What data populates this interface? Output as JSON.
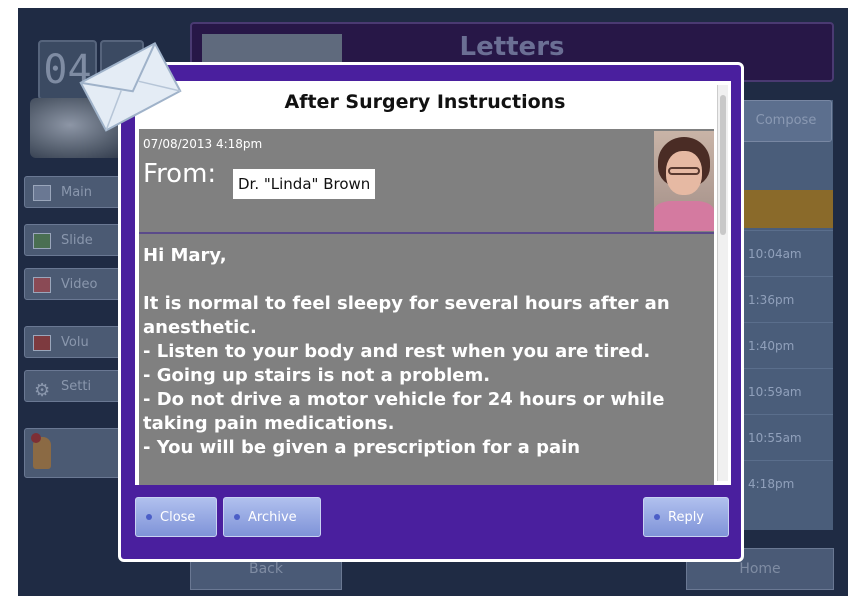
{
  "background_app": {
    "clock_digits": "04",
    "sidebar": [
      {
        "label": "Main",
        "style": "plain"
      },
      {
        "label": "Slide",
        "style": "green"
      },
      {
        "label": "Video",
        "style": "pink"
      },
      {
        "label": "Volu",
        "style": "red"
      },
      {
        "label": "Setti",
        "style": "gear"
      }
    ],
    "header_title": "Letters",
    "compose_label": "Compose",
    "times": [
      "10:04am",
      "1:36pm",
      "1:40pm",
      "10:59am",
      "10:55am",
      "4:18pm"
    ],
    "back_label": "Back",
    "home_label": "Home"
  },
  "dialog": {
    "title": "After Surgery Instructions",
    "date": "07/08/2013 4:18pm",
    "from_label": "From:",
    "from_name": "Dr. \"Linda\" Brown",
    "body": "Hi Mary,\n\nIt is normal to feel sleepy for several hours after an anesthetic.\n- Listen to your body and rest when you are tired.\n- Going up stairs is not a problem.\n- Do not drive a motor vehicle for 24 hours or while taking pain medications.\n- You will be given a prescription for a pain",
    "buttons": {
      "close": "Close",
      "archive": "Archive",
      "reply": "Reply"
    }
  },
  "colors": {
    "dialog_border": "#4a1f9e",
    "message_bg": "#808080",
    "button_bg": "#8fa2e0"
  }
}
